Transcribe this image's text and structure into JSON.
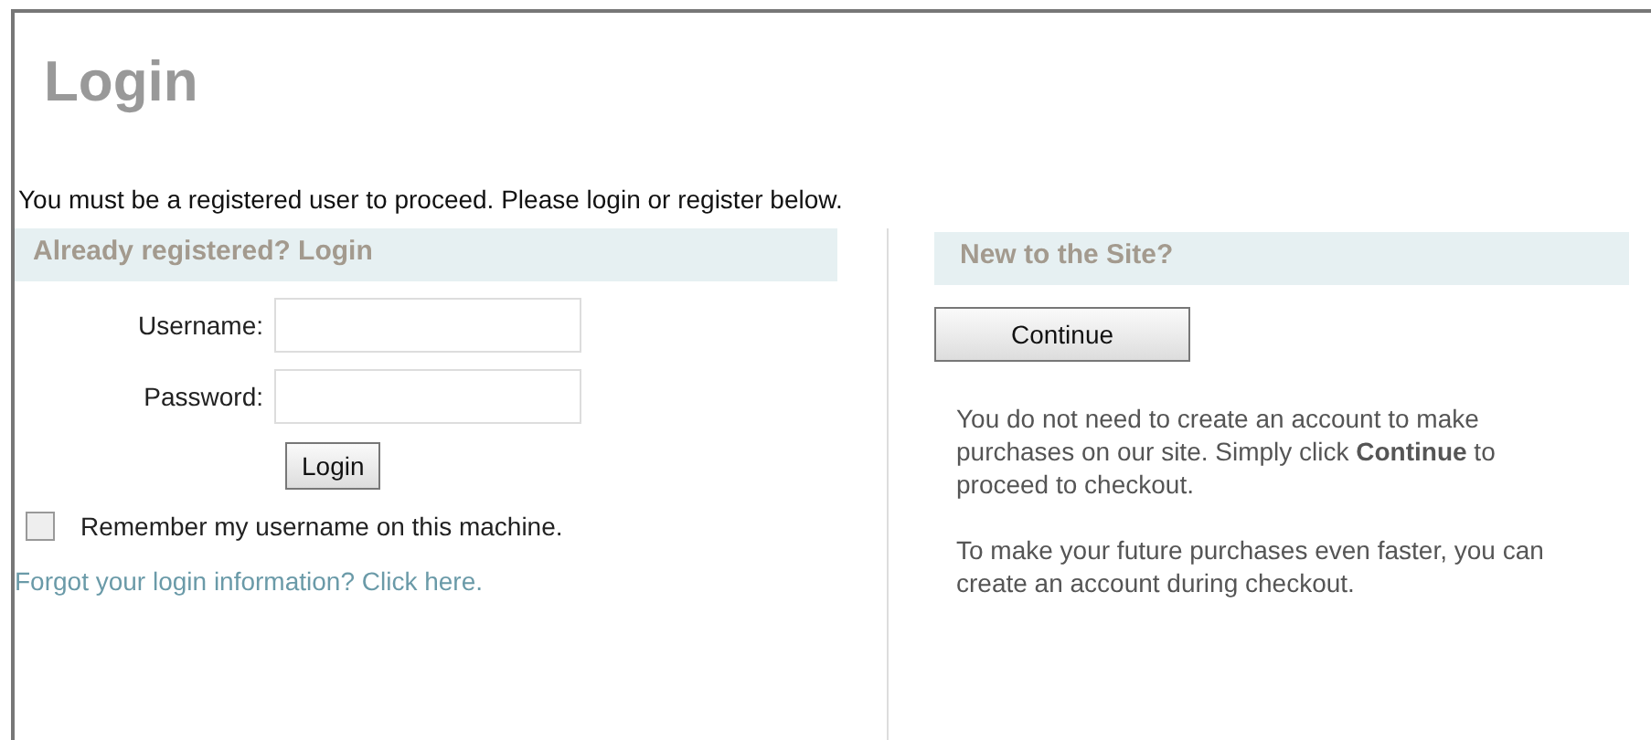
{
  "title": "Login",
  "intro": "You must be a registered user to proceed. Please login or register below.",
  "login_panel": {
    "heading": "Already registered? Login",
    "fields": [
      {
        "label": "Username:"
      },
      {
        "label": "Password:"
      }
    ],
    "button": "Login",
    "remember": {
      "label": "Remember my username on this machine.",
      "checked": false
    },
    "forgot_link": "Forgot your login information? Click here."
  },
  "new_panel": {
    "heading": "New to the Site?",
    "button": "Continue",
    "paragraphs": [
      "You do not need to create an account to make purchases on our site. Simply click **Continue** to proceed to checkout.",
      "To make your future purchases even faster, you can create an account during checkout."
    ]
  }
}
